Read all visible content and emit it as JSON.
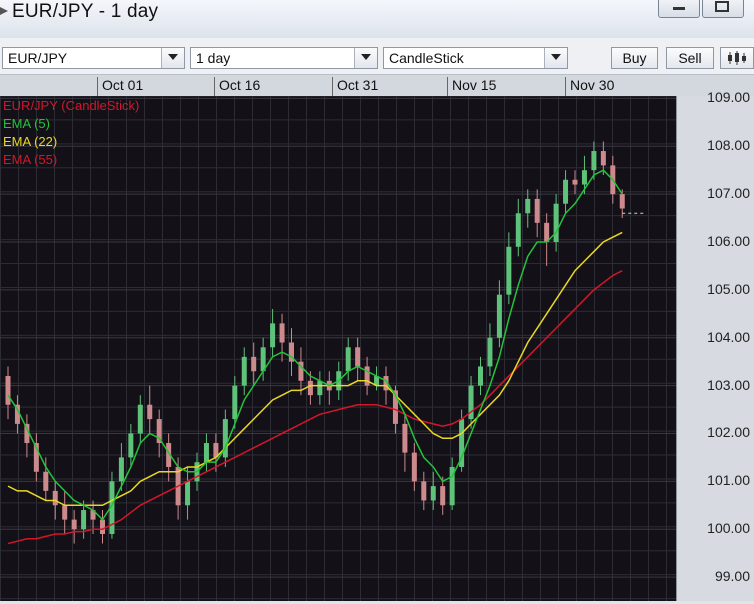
{
  "window": {
    "title": "EUR/JPY - 1 day"
  },
  "toolbar": {
    "symbol": "EUR/JPY",
    "timeframe": "1 day",
    "chart_type": "CandleStick",
    "buy_label": "Buy",
    "sell_label": "Sell"
  },
  "colors": {
    "background": "#141018",
    "up": "#5ec27a",
    "down": "#cc8a8c",
    "ema5": "#22c43a",
    "ema22": "#e8d825",
    "ema55": "#d4162a"
  },
  "chart_data": {
    "type": "candlestick",
    "x_ticks": [
      "Oct 01",
      "Oct 16",
      "Oct 31",
      "Nov 15",
      "Nov 30"
    ],
    "y_ticks": [
      "109.00",
      "108.00",
      "107.00",
      "106.00",
      "105.00",
      "104.00",
      "103.00",
      "102.00",
      "101.00",
      "100.00",
      "99.00"
    ],
    "ylim": [
      98.5,
      109.05
    ],
    "grid": true,
    "legend": [
      {
        "label": "EUR/JPY (CandleStick)",
        "color": "#d4162a"
      },
      {
        "label": "EMA (5)",
        "color": "#22c43a"
      },
      {
        "label": "EMA (22)",
        "color": "#e8d825"
      },
      {
        "label": "EMA (55)",
        "color": "#d4162a"
      }
    ],
    "candles": [
      [
        103.2,
        102.6,
        103.4,
        102.3
      ],
      [
        102.6,
        102.2,
        102.8,
        102.0
      ],
      [
        102.2,
        101.8,
        102.4,
        101.5
      ],
      [
        101.8,
        101.2,
        102.0,
        101.0
      ],
      [
        101.2,
        100.8,
        101.5,
        100.6
      ],
      [
        100.8,
        100.5,
        101.0,
        100.2
      ],
      [
        100.5,
        100.2,
        100.8,
        99.9
      ],
      [
        100.2,
        100.0,
        100.4,
        99.7
      ],
      [
        100.0,
        100.4,
        100.6,
        99.8
      ],
      [
        100.4,
        100.2,
        100.6,
        99.9
      ],
      [
        100.2,
        99.9,
        100.4,
        99.7
      ],
      [
        99.9,
        101.0,
        101.2,
        99.8
      ],
      [
        101.0,
        101.5,
        101.8,
        100.8
      ],
      [
        101.5,
        102.0,
        102.2,
        101.3
      ],
      [
        102.0,
        102.6,
        102.8,
        101.8
      ],
      [
        102.6,
        102.3,
        103.0,
        102.0
      ],
      [
        102.3,
        101.8,
        102.5,
        101.5
      ],
      [
        101.8,
        101.3,
        102.0,
        101.0
      ],
      [
        101.3,
        100.5,
        101.5,
        100.2
      ],
      [
        100.5,
        101.0,
        101.3,
        100.2
      ],
      [
        101.0,
        101.4,
        101.6,
        100.8
      ],
      [
        101.4,
        101.8,
        102.0,
        101.2
      ],
      [
        101.8,
        101.5,
        102.0,
        101.2
      ],
      [
        101.5,
        102.3,
        102.5,
        101.3
      ],
      [
        102.3,
        103.0,
        103.2,
        102.1
      ],
      [
        103.0,
        103.6,
        103.8,
        102.8
      ],
      [
        103.6,
        103.3,
        103.9,
        103.0
      ],
      [
        103.3,
        103.8,
        104.0,
        103.1
      ],
      [
        103.8,
        104.3,
        104.6,
        103.6
      ],
      [
        104.3,
        103.9,
        104.5,
        103.5
      ],
      [
        103.9,
        103.5,
        104.2,
        103.2
      ],
      [
        103.5,
        103.1,
        103.8,
        102.8
      ],
      [
        103.1,
        102.8,
        103.3,
        102.6
      ],
      [
        102.8,
        103.1,
        103.3,
        102.6
      ],
      [
        103.1,
        102.9,
        103.3,
        102.6
      ],
      [
        102.9,
        103.3,
        103.5,
        102.7
      ],
      [
        103.3,
        103.8,
        104.0,
        103.1
      ],
      [
        103.8,
        103.4,
        104.0,
        103.1
      ],
      [
        103.4,
        103.0,
        103.6,
        102.8
      ],
      [
        103.0,
        103.2,
        103.4,
        102.9
      ],
      [
        103.2,
        102.9,
        103.4,
        102.6
      ],
      [
        102.9,
        102.2,
        103.0,
        102.0
      ],
      [
        102.2,
        101.6,
        102.4,
        101.2
      ],
      [
        101.6,
        101.0,
        101.8,
        100.8
      ],
      [
        101.0,
        100.6,
        101.2,
        100.4
      ],
      [
        100.6,
        100.9,
        101.2,
        100.4
      ],
      [
        100.9,
        100.5,
        101.1,
        100.3
      ],
      [
        100.5,
        101.3,
        101.5,
        100.4
      ],
      [
        101.3,
        102.3,
        102.5,
        101.2
      ],
      [
        102.3,
        103.0,
        103.2,
        102.1
      ],
      [
        103.0,
        103.4,
        103.6,
        102.8
      ],
      [
        103.4,
        104.0,
        104.3,
        103.2
      ],
      [
        104.0,
        104.9,
        105.2,
        103.8
      ],
      [
        104.9,
        105.9,
        106.2,
        104.7
      ],
      [
        105.9,
        106.6,
        106.9,
        105.7
      ],
      [
        106.6,
        106.9,
        107.1,
        106.3
      ],
      [
        106.9,
        106.4,
        107.1,
        106.1
      ],
      [
        106.4,
        106.0,
        106.6,
        105.5
      ],
      [
        106.0,
        106.8,
        107.0,
        105.8
      ],
      [
        106.8,
        107.3,
        107.5,
        106.6
      ],
      [
        107.3,
        107.2,
        107.5,
        107.0
      ],
      [
        107.2,
        107.5,
        107.8,
        107.0
      ],
      [
        107.5,
        107.9,
        108.1,
        107.3
      ],
      [
        107.9,
        107.6,
        108.1,
        107.4
      ],
      [
        107.6,
        107.0,
        107.8,
        106.8
      ],
      [
        107.0,
        106.7,
        107.1,
        106.5
      ]
    ],
    "ema5": [
      102.8,
      102.5,
      102.1,
      101.7,
      101.3,
      101.0,
      100.8,
      100.6,
      100.5,
      100.4,
      100.2,
      100.5,
      100.9,
      101.3,
      101.8,
      102.0,
      101.9,
      101.6,
      101.3,
      101.2,
      101.2,
      101.4,
      101.4,
      101.7,
      102.2,
      102.7,
      103.0,
      103.3,
      103.6,
      103.7,
      103.6,
      103.4,
      103.2,
      103.1,
      103.0,
      103.1,
      103.3,
      103.4,
      103.3,
      103.2,
      103.1,
      102.8,
      102.4,
      101.9,
      101.5,
      101.3,
      101.0,
      101.1,
      101.5,
      102.0,
      102.5,
      103.0,
      103.6,
      104.4,
      105.1,
      105.7,
      106.0,
      106.0,
      106.2,
      106.6,
      106.8,
      107.1,
      107.4,
      107.5,
      107.3,
      107.0
    ],
    "ema22": [
      100.9,
      100.8,
      100.8,
      100.7,
      100.6,
      100.6,
      100.5,
      100.5,
      100.5,
      100.5,
      100.5,
      100.6,
      100.7,
      100.8,
      101.0,
      101.1,
      101.2,
      101.2,
      101.2,
      101.3,
      101.3,
      101.4,
      101.5,
      101.7,
      101.9,
      102.1,
      102.3,
      102.5,
      102.7,
      102.8,
      102.9,
      102.9,
      103.0,
      103.0,
      103.0,
      103.0,
      103.0,
      103.1,
      103.1,
      103.0,
      103.0,
      102.8,
      102.6,
      102.4,
      102.2,
      102.0,
      101.9,
      101.9,
      102.0,
      102.2,
      102.4,
      102.6,
      102.8,
      103.1,
      103.5,
      103.9,
      104.2,
      104.5,
      104.8,
      105.1,
      105.4,
      105.6,
      105.8,
      106.0,
      106.1,
      106.2
    ],
    "ema55": [
      99.7,
      99.75,
      99.8,
      99.8,
      99.85,
      99.9,
      99.9,
      99.95,
      99.95,
      100.0,
      100.0,
      100.1,
      100.2,
      100.35,
      100.5,
      100.6,
      100.7,
      100.8,
      100.9,
      101.0,
      101.1,
      101.2,
      101.3,
      101.4,
      101.5,
      101.6,
      101.7,
      101.8,
      101.9,
      102.0,
      102.1,
      102.2,
      102.3,
      102.4,
      102.45,
      102.5,
      102.55,
      102.6,
      102.6,
      102.6,
      102.55,
      102.5,
      102.4,
      102.3,
      102.25,
      102.2,
      102.15,
      102.2,
      102.3,
      102.45,
      102.6,
      102.8,
      103.0,
      103.2,
      103.4,
      103.6,
      103.8,
      104.0,
      104.2,
      104.4,
      104.6,
      104.8,
      105.0,
      105.15,
      105.3,
      105.4
    ],
    "current_price": 106.6
  }
}
